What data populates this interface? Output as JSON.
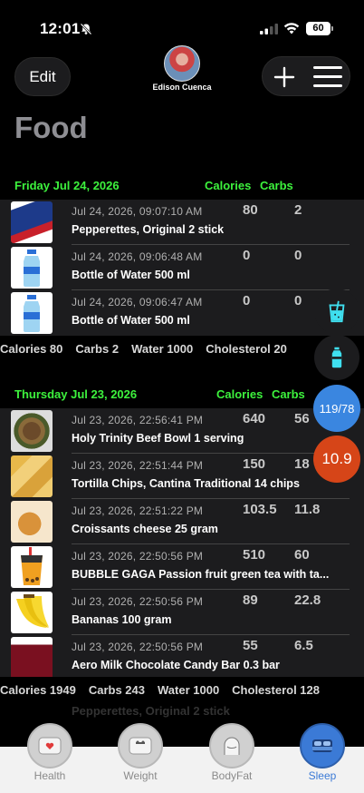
{
  "status": {
    "time": "12:01",
    "battery": "60"
  },
  "header": {
    "edit_label": "Edit",
    "user_name": "Edison Cuenca",
    "title": "Food"
  },
  "columns": {
    "calories": "Calories",
    "carbs": "Carbs"
  },
  "sections": [
    {
      "date": "Friday Jul 24, 2026",
      "rows": [
        {
          "time": "Jul 24, 2026, 09:07:10 AM",
          "calories": "80",
          "carbs": "2",
          "name": "Pepperettes, Original 2 stick",
          "icon": "pepperettes-photo"
        },
        {
          "time": "Jul 24, 2026, 09:06:48 AM",
          "calories": "0",
          "carbs": "0",
          "name": "Bottle of Water 500 ml",
          "icon": "water-bottle-photo"
        },
        {
          "time": "Jul 24, 2026, 09:06:47 AM",
          "calories": "0",
          "carbs": "0",
          "name": "Bottle of Water 500 ml",
          "icon": "water-bottle-photo"
        }
      ],
      "totals": {
        "calories": "Calories 80",
        "carbs": "Carbs 2",
        "water": "Water 1000",
        "cholesterol": "Cholesterol 20"
      }
    },
    {
      "date": "Thursday Jul 23, 2026",
      "rows": [
        {
          "time": "Jul 23, 2026, 22:56:41 PM",
          "calories": "640",
          "carbs": "56",
          "name": "Holy Trinity Beef Bowl 1 serving",
          "icon": "beef-bowl-photo"
        },
        {
          "time": "Jul 23, 2026, 22:51:44 PM",
          "calories": "150",
          "carbs": "18",
          "name": "Tortilla Chips, Cantina Traditional 14 chips",
          "icon": "tortilla-chips-photo"
        },
        {
          "time": "Jul 23, 2026, 22:51:22 PM",
          "calories": "103.5",
          "carbs": "11.8",
          "name": "Croissants cheese 25 gram",
          "icon": "croissant-photo"
        },
        {
          "time": "Jul 23, 2026, 22:50:56 PM",
          "calories": "510",
          "carbs": "60",
          "name": "BUBBLE GAGA  Passion fruit green tea with ta...",
          "icon": "bubble-tea-photo"
        },
        {
          "time": "Jul 23, 2026, 22:50:56 PM",
          "calories": "89",
          "carbs": "22.8",
          "name": "Bananas  100 gram",
          "icon": "banana-photo"
        },
        {
          "time": "Jul 23, 2026, 22:50:56 PM",
          "calories": "55",
          "carbs": "6.5",
          "name": "Aero Milk Chocolate Candy Bar 0.3 bar",
          "icon": "aero-bar-photo"
        }
      ],
      "totals": {
        "calories": "Calories 1949",
        "carbs": "Carbs 243",
        "water": "Water 1000",
        "cholesterol": "Cholesterol 128"
      }
    }
  ],
  "ghost_row": "Pepperettes, Original 2 stick",
  "floating": {
    "blood_pressure": "119/78",
    "glucose": "10.9"
  },
  "tabs": [
    {
      "label": "Health",
      "icon": "heart-scale-icon"
    },
    {
      "label": "Weight",
      "icon": "scale-icon"
    },
    {
      "label": "BodyFat",
      "icon": "body-icon"
    },
    {
      "label": "Sleep",
      "icon": "bed-icon",
      "active": true
    }
  ],
  "colors": {
    "accent_green": "#3df23d",
    "blue": "#3a86e0",
    "orange": "#d64518"
  }
}
